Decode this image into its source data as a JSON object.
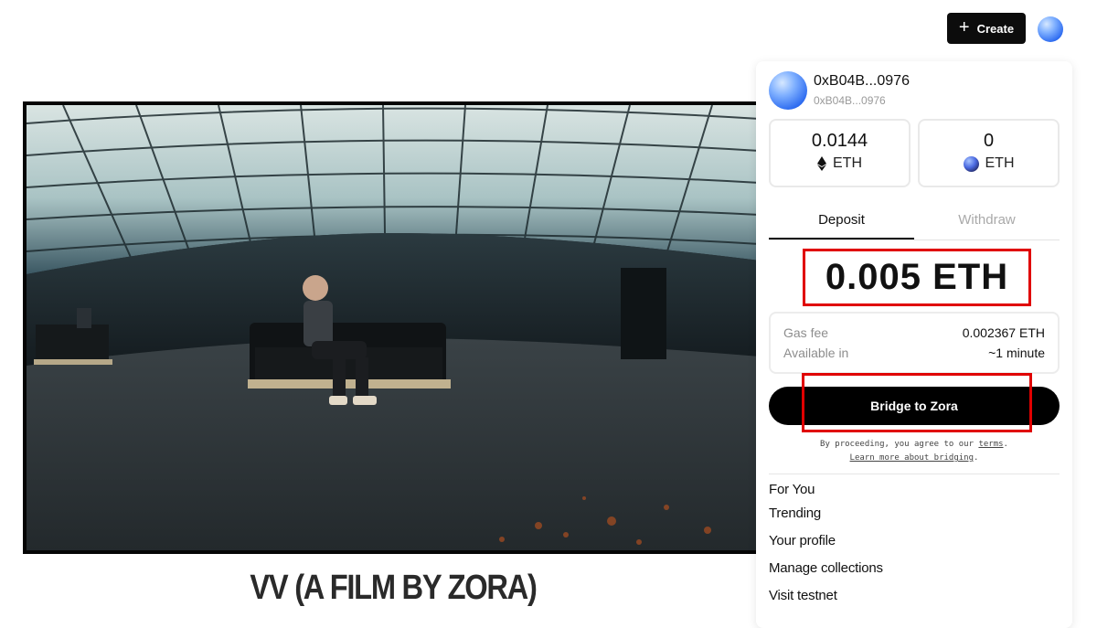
{
  "header": {
    "create_label": "Create",
    "create_icon": "plus-icon",
    "avatar_icon": "avatar-orb"
  },
  "video": {
    "title": "VV (A FILM BY ZORA)"
  },
  "wallet": {
    "account_name": "0xB04B...0976",
    "account_sub": "0xB04B...0976",
    "balances": [
      {
        "value": "0.0144",
        "unit": "ETH",
        "icon": "ethereum-icon"
      },
      {
        "value": "0",
        "unit": "ETH",
        "icon": "zora-orb-icon"
      }
    ],
    "tabs": [
      {
        "label": "Deposit",
        "active": true
      },
      {
        "label": "Withdraw",
        "active": false
      }
    ],
    "amount": "0.005 ETH",
    "fees": {
      "gas_label": "Gas fee",
      "gas_value": "0.002367 ETH",
      "available_label": "Available in",
      "available_value": "~1 minute"
    },
    "bridge_label": "Bridge to Zora",
    "legal": {
      "prefix": "By proceeding, you agree to our ",
      "terms": "terms",
      "suffix": ".",
      "learn": "Learn more about bridging",
      "learn_suffix": "."
    },
    "menu": [
      "For You",
      "Trending",
      "Your profile",
      "Manage collections",
      "Visit testnet"
    ]
  },
  "colors": {
    "highlight": "#e00000",
    "button_bg": "#000000",
    "accent_blue": "#2e6cf0"
  }
}
